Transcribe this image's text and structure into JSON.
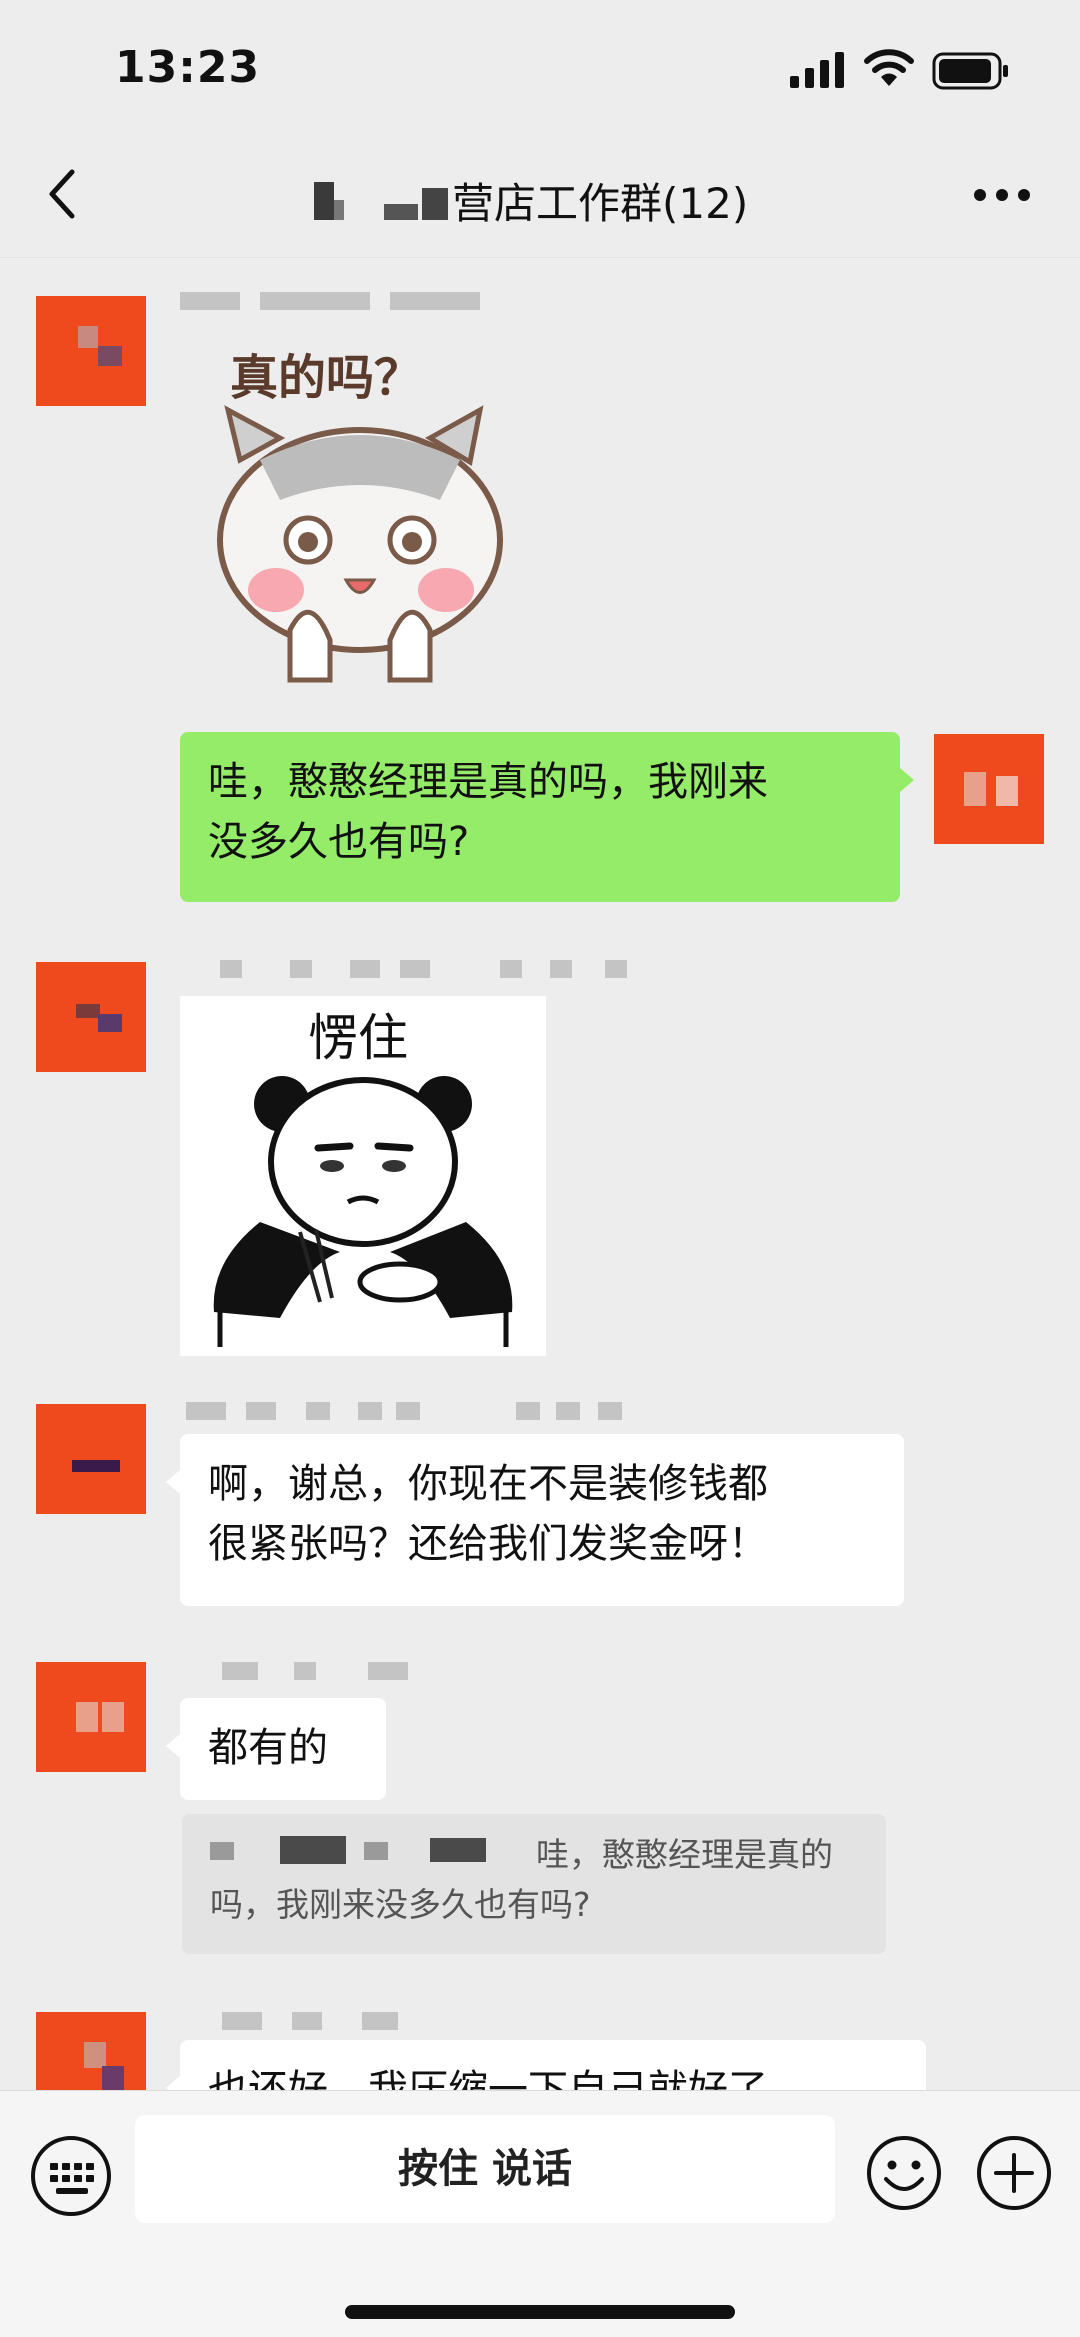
{
  "status_bar": {
    "time": "13:23"
  },
  "header": {
    "title": "营店工作群(12)",
    "back_icon": "chevron-left-icon",
    "more_icon": "ellipsis-icon"
  },
  "messages": [
    {
      "type": "sticker",
      "side": "left",
      "caption": "真的吗？",
      "sticker_icon": "surprised-cat-sticker"
    },
    {
      "type": "text",
      "side": "right",
      "lines": [
        "哇，憨憨经理是真的吗，我刚来",
        "没多久也有吗?"
      ]
    },
    {
      "type": "sticker",
      "side": "left",
      "caption": "愣住",
      "sticker_icon": "stunned-panda-sticker"
    },
    {
      "type": "text",
      "side": "left",
      "lines": [
        "啊，谢总，你现在不是装修钱都",
        "很紧张吗？还给我们发奖金呀！"
      ]
    },
    {
      "type": "text",
      "side": "left",
      "lines": [
        "都有的"
      ],
      "quote": {
        "lines": [
          "哇，憨憨经理是真的",
          "吗，我刚来没多久也有吗?"
        ]
      }
    },
    {
      "type": "text",
      "side": "left",
      "lines": [
        "也还好，我压缩一下自己就好了"
      ]
    }
  ],
  "input_bar": {
    "hold_to_talk": "按住 说话",
    "keyboard_icon": "keyboard-icon",
    "emoji_icon": "smiley-icon",
    "plus_icon": "plus-circle-icon"
  },
  "colors": {
    "background": "#ededed",
    "self_bubble": "#95ec69",
    "other_bubble": "#ffffff",
    "avatar": "#ee4a1e"
  }
}
